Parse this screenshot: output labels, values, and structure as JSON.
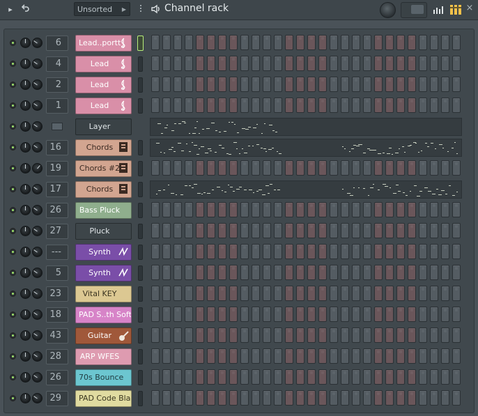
{
  "header": {
    "sort_label": "Unsorted",
    "title": "Channel rack"
  },
  "channels": [
    {
      "mixer": "6",
      "name": "Lead..portt",
      "icon": "treble-clef-icon",
      "glyph": "𝄞",
      "bg": "#d98fa8",
      "fg": "#ffffff",
      "pattern": "steps",
      "selected": true
    },
    {
      "mixer": "4",
      "name": "Lead",
      "icon": "treble-clef-icon",
      "glyph": "𝄞",
      "bg": "#d98fa8",
      "fg": "#ffffff",
      "pattern": "steps"
    },
    {
      "mixer": "2",
      "name": "Lead",
      "icon": "treble-clef-icon",
      "glyph": "𝄞",
      "bg": "#d98fa8",
      "fg": "#ffffff",
      "pattern": "steps"
    },
    {
      "mixer": "1",
      "name": "Lead",
      "icon": "treble-clef-icon",
      "glyph": "𝄞",
      "bg": "#d98fa8",
      "fg": "#ffffff",
      "pattern": "steps"
    },
    {
      "mixer": "",
      "name": "Layer",
      "icon": "layer-icon",
      "glyph": "",
      "bg": "#3a4246",
      "fg": "#e0e5e8",
      "pattern": "roll",
      "no_sel": true
    },
    {
      "mixer": "16",
      "name": "Chords",
      "icon": "chords-plugin-icon",
      "glyph": "▐",
      "bg": "#d2a590",
      "fg": "#3b2a22",
      "pattern": "roll"
    },
    {
      "mixer": "19",
      "name": "Chords #2",
      "icon": "chords-plugin-icon",
      "glyph": "▐",
      "bg": "#d2a590",
      "fg": "#3b2a22",
      "pattern": "steps",
      "vol_rot": true
    },
    {
      "mixer": "17",
      "name": "Chords",
      "icon": "chords-plugin-icon",
      "glyph": "▐",
      "bg": "#d2a590",
      "fg": "#3b2a22",
      "pattern": "roll"
    },
    {
      "mixer": "26",
      "name": "Bass Pluck",
      "icon": "",
      "glyph": "",
      "bg": "#8fae8d",
      "fg": "#ffffff",
      "pattern": "steps"
    },
    {
      "mixer": "27",
      "name": "Pluck",
      "icon": "",
      "glyph": "",
      "bg": "#3d4549",
      "fg": "#e0e5e8",
      "pattern": "steps"
    },
    {
      "mixer": "---",
      "name": "Synth",
      "icon": "wave-icon",
      "glyph": "⁄",
      "bg": "#7a4ea8",
      "fg": "#ffffff",
      "pattern": "steps"
    },
    {
      "mixer": "5",
      "name": "Synth",
      "icon": "wave-icon",
      "glyph": "⁄",
      "bg": "#7a4ea8",
      "fg": "#ffffff",
      "pattern": "steps"
    },
    {
      "mixer": "23",
      "name": "Vital KEY",
      "icon": "",
      "glyph": "",
      "bg": "#dcc892",
      "fg": "#3a3320",
      "pattern": "steps"
    },
    {
      "mixer": "18",
      "name": "PAD   S..th Soft",
      "icon": "",
      "glyph": "",
      "bg": "#d784c8",
      "fg": "#ffffff",
      "pattern": "steps"
    },
    {
      "mixer": "43",
      "name": "Guitar",
      "icon": "guitar-icon",
      "glyph": "🎸",
      "bg": "#a0583a",
      "fg": "#ffffff",
      "pattern": "steps"
    },
    {
      "mixer": "28",
      "name": "ARP  WFES",
      "icon": "",
      "glyph": "",
      "bg": "#de9bb0",
      "fg": "#ffffff",
      "pattern": "steps"
    },
    {
      "mixer": "26",
      "name": "70s Bounce",
      "icon": "",
      "glyph": "",
      "bg": "#6cc6d0",
      "fg": "#1f3a3f",
      "pattern": "steps"
    },
    {
      "mixer": "29",
      "name": "PAD  Code Black",
      "icon": "",
      "glyph": "",
      "bg": "#e0dba0",
      "fg": "#3a3720",
      "pattern": "steps"
    }
  ],
  "colors": {
    "step_normal": "#545c62",
    "step_accent": "#6a565a",
    "led_on": "#9ee06a",
    "note_color": "#c9d0c0"
  },
  "steps_per_row": 28
}
